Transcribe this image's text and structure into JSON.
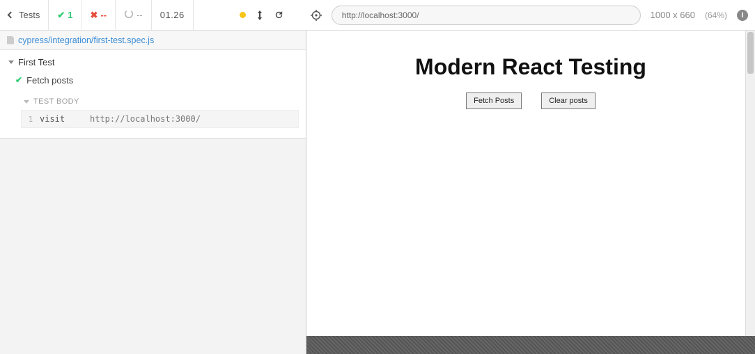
{
  "toolbar": {
    "back_label": "Tests",
    "passed_count": "1",
    "failed_count": "--",
    "pending_count": "--",
    "duration": "01.26"
  },
  "url_bar": {
    "url": "http://localhost:3000/",
    "viewport": "1000 x 660",
    "zoom": "(64%)"
  },
  "spec": {
    "file_path": "cypress/integration/first-test.spec.js"
  },
  "suite": {
    "title": "First Test",
    "tests": [
      {
        "title": "Fetch posts",
        "status": "passed"
      }
    ],
    "body_header": "TEST BODY",
    "commands": [
      {
        "num": "1",
        "name": "visit",
        "message": "http://localhost:3000/"
      }
    ]
  },
  "app": {
    "heading": "Modern React Testing",
    "buttons": {
      "fetch": "Fetch Posts",
      "clear": "Clear posts"
    }
  }
}
